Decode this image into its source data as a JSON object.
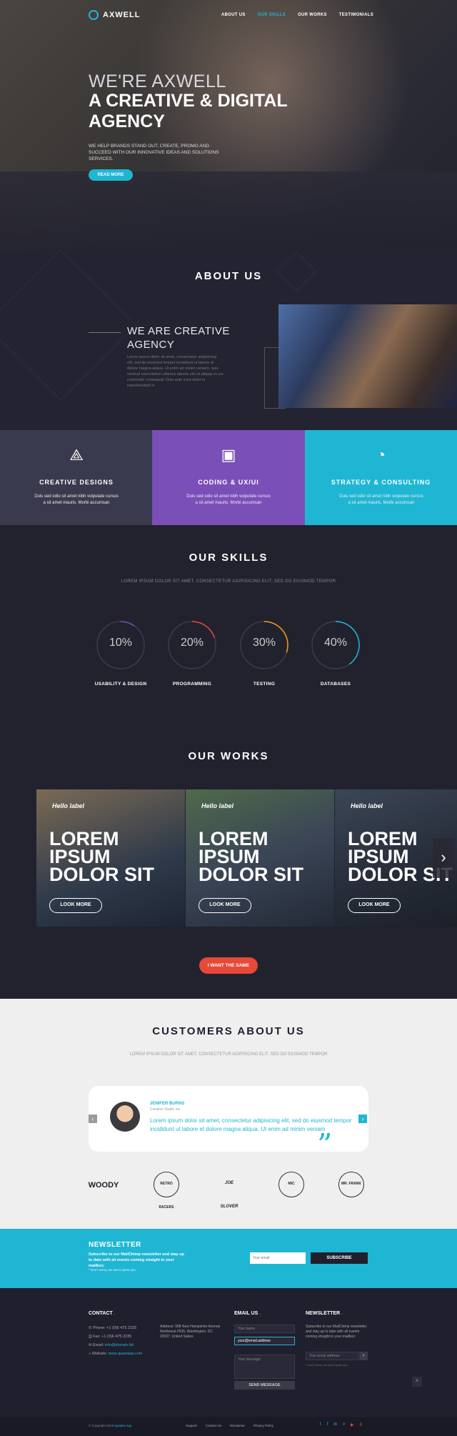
{
  "header": {
    "logo": "AXWELL",
    "nav": [
      "ABOUT US",
      "OUR SKILLS",
      "OUR WORKS",
      "TESTIMONIALS"
    ]
  },
  "hero": {
    "line1": "WE'RE AXWELL",
    "line2": "A CREATIVE & DIGITAL AGENCY",
    "text": "WE HELP BRANDS STAND OUT, CREATE, PROMO AND SUCCEED WITH OUR INNOVATIVE IDEAS AND SOLUTIONS SERVICES.",
    "button": "READ MORE"
  },
  "about": {
    "title": "ABOUT US",
    "heading": "WE ARE CREATIVE AGENCY",
    "text": "Lorem ipsum dolor sit amet, consectetur adipisicing elit, sed do eiusmod tempor incididunt ut labore et dolore magna aliqua. Ut enim ad minim veniam, quis nostrud exercitation ullamco laboris nisi ut aliquip ex ea commodo consequat. Duis aute irure dolor in reprehenderit in"
  },
  "features": [
    {
      "title": "CREATIVE DESIGNS",
      "text": "Duis sed odio sit amet nibh vulputate cursus a sit amet mauris. Morbi accumsan",
      "icon": "compass-icon",
      "color": "#3a3a4e"
    },
    {
      "title": "CODING & UX/UI",
      "text": "Duis sed odio sit amet nibh vulputate cursus a sit amet mauris. Morbi accumsan",
      "icon": "browser-window-icon",
      "color": "#7b4fb8"
    },
    {
      "title": "STRATEGY & CONSULTING",
      "text": "Duis sed odio sit amet nibh vulputate cursus a sit amet mauris. Morbi accumsan",
      "icon": "stopwatch-icon",
      "color": "#1fb6d4"
    }
  ],
  "skills": {
    "title": "OUR SKILLS",
    "subtitle": "LOREM IPSUM DOLOR SIT AMET, CONSECTETUR ADIPISICING ELIT, SED DO EIUSMOD TEMPOR",
    "items": [
      {
        "label": "USABILITY & DESIGN",
        "percent": "10%",
        "value": 10,
        "color": "#7b4fb8"
      },
      {
        "label": "PROGRAMMING",
        "percent": "20%",
        "value": 20,
        "color": "#e84837"
      },
      {
        "label": "TESTING",
        "percent": "30%",
        "value": 30,
        "color": "#f39c12"
      },
      {
        "label": "DATABASES",
        "percent": "40%",
        "value": 40,
        "color": "#1fb6d4"
      }
    ]
  },
  "works": {
    "title": "OUR WORKS",
    "items": [
      {
        "label": "Hello label",
        "text": "LOREM IPSUM DOLOR SIT",
        "button": "LOOK MORE"
      },
      {
        "label": "Hello label",
        "text": "LOREM IPSUM DOLOR SIT",
        "button": "LOOK MORE"
      },
      {
        "label": "Hello label",
        "text": "LOREM IPSUM DOLOR SIT",
        "button": "LOOK MORE"
      }
    ],
    "cta": "I WANT THE SAME"
  },
  "customers": {
    "title": "CUSTOMERS ABOUT US",
    "subtitle": "LOREM IPSUM DOLOR SIT AMET, CONSECTETUR ADIPISICING ELIT, SED DO EIUSMOD TEMPOR",
    "name": "JENIFER BURNS",
    "role": "Creative Studio Inc.",
    "text": "Lorem ipsum dolor sit amet, consectetur adipisicing elit, sed do eiusmod tempor incididunt ut labore et dolore magna aliqua. Ut enim ad minim veniam",
    "brands": [
      "WOODY",
      "RETRO RACERS",
      "JOE SLOVER",
      "MIC",
      "MR. FRANK"
    ]
  },
  "newsletter": {
    "title": "NEWSLETTER",
    "text": "Subscribe to our MailChimp newsletter and stay up to date with all events coming straight in your mailbox:",
    "small": "* Don't worry, we won't spam you.",
    "placeholder": "Your email",
    "button": "SUBSCRIBE"
  },
  "footer": {
    "contact_title": "CONTACT",
    "phone": "Phone: +1 (0)6 475 2235",
    "fax": "Fax: +1 (0)6 475 2235",
    "email_label": "Email: ",
    "email": "info@domain.ltd",
    "website_label": "Website: ",
    "website": "www.quantasp.com",
    "address": "Address: 998 New Hampshire Avenue Northwest #535, Washington, DC 20037, United States",
    "email_us_title": "EMAIL US",
    "name_placeholder": "Your name",
    "email_value": "your@email.address",
    "message_placeholder": "Your message",
    "send": "SEND MESSAGE",
    "newsletter_title": "NEWSLETTER",
    "newsletter_text": "Subscribe to our MailChimp newsletter and stay up to date with all events coming straight in your mailbox:",
    "newsletter_placeholder": "Your email address",
    "newsletter_small": "* Don't worry, we won't spam you.",
    "copyright_prefix": "© Copyright 2016 ",
    "copyright_brand": "Quadra App",
    "links": [
      "Support",
      "Contact Us",
      "Disclaimer",
      "Privacy Policy"
    ]
  }
}
